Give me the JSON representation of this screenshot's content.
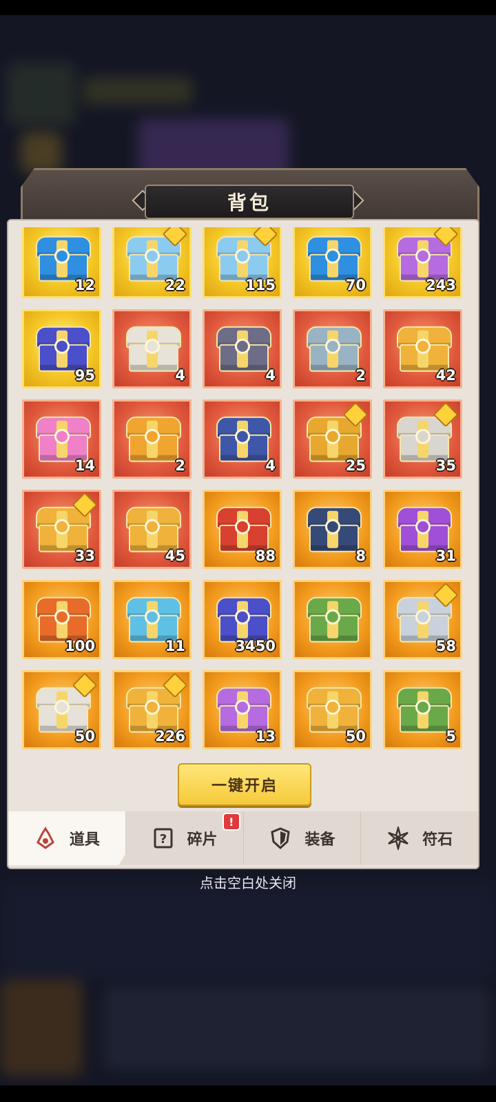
{
  "header": {
    "title": "背包"
  },
  "items": [
    {
      "count": "12",
      "bg": "gold",
      "chest": "#2f8fe0",
      "star": false
    },
    {
      "count": "22",
      "bg": "gold",
      "chest": "#8ccbf0",
      "star": true
    },
    {
      "count": "115",
      "bg": "gold",
      "chest": "#8ccbf0",
      "star": true
    },
    {
      "count": "70",
      "bg": "gold",
      "chest": "#2f8fe0",
      "star": false
    },
    {
      "count": "243",
      "bg": "gold",
      "chest": "#b66be0",
      "star": true
    },
    {
      "count": "95",
      "bg": "gold",
      "chest": "#4b4fc9",
      "star": false
    },
    {
      "count": "4",
      "bg": "red",
      "chest": "#e8e3d8",
      "star": false
    },
    {
      "count": "4",
      "bg": "red",
      "chest": "#6d6d88",
      "star": false
    },
    {
      "count": "2",
      "bg": "red",
      "chest": "#9ab3c4",
      "star": false
    },
    {
      "count": "42",
      "bg": "red",
      "chest": "#f0b23a",
      "star": false
    },
    {
      "count": "14",
      "bg": "red",
      "chest": "#f080c8",
      "star": false
    },
    {
      "count": "2",
      "bg": "red",
      "chest": "#f0a530",
      "star": false
    },
    {
      "count": "4",
      "bg": "red",
      "chest": "#3f57a8",
      "star": false
    },
    {
      "count": "25",
      "bg": "red",
      "chest": "#e8a82f",
      "star": true
    },
    {
      "count": "35",
      "bg": "red",
      "chest": "#d9d6d0",
      "star": true
    },
    {
      "count": "33",
      "bg": "red",
      "chest": "#f0b23a",
      "star": true
    },
    {
      "count": "45",
      "bg": "red",
      "chest": "#f0b23a",
      "star": false
    },
    {
      "count": "88",
      "bg": "orange",
      "chest": "#d8402f",
      "star": false
    },
    {
      "count": "8",
      "bg": "orange",
      "chest": "#364a78",
      "star": false
    },
    {
      "count": "31",
      "bg": "orange",
      "chest": "#a04fd8",
      "star": false
    },
    {
      "count": "100",
      "bg": "orange",
      "chest": "#e86b2a",
      "star": false
    },
    {
      "count": "11",
      "bg": "orange",
      "chest": "#5fc0e6",
      "star": false
    },
    {
      "count": "3450",
      "bg": "orange",
      "chest": "#4b4fc9",
      "star": false
    },
    {
      "count": "",
      "bg": "orange",
      "chest": "#6aa94a",
      "star": false
    },
    {
      "count": "58",
      "bg": "orange",
      "chest": "#c9d2dc",
      "star": true
    },
    {
      "count": "50",
      "bg": "orange",
      "chest": "#e6e2da",
      "star": true
    },
    {
      "count": "226",
      "bg": "orange",
      "chest": "#f0b23a",
      "star": true
    },
    {
      "count": "13",
      "bg": "orange",
      "chest": "#b66be0",
      "star": false
    },
    {
      "count": "50",
      "bg": "orange",
      "chest": "#f0b23a",
      "star": false
    },
    {
      "count": "5",
      "bg": "orange",
      "chest": "#6aa94a",
      "star": false
    }
  ],
  "actions": {
    "open_all": "一键开启"
  },
  "tabs": [
    {
      "label": "道具",
      "icon": "potion-icon",
      "active": true
    },
    {
      "label": "碎片",
      "icon": "question-card-icon",
      "active": false,
      "alert": "!"
    },
    {
      "label": "装备",
      "icon": "shield-icon",
      "active": false
    },
    {
      "label": "符石",
      "icon": "rune-star-icon",
      "active": false
    }
  ],
  "footer": {
    "close_hint": "点击空白处关闭"
  },
  "colors": {
    "gold": "#f4c726",
    "red": "#e0583c",
    "orange": "#f29a1d",
    "button": "#f6c93a"
  }
}
